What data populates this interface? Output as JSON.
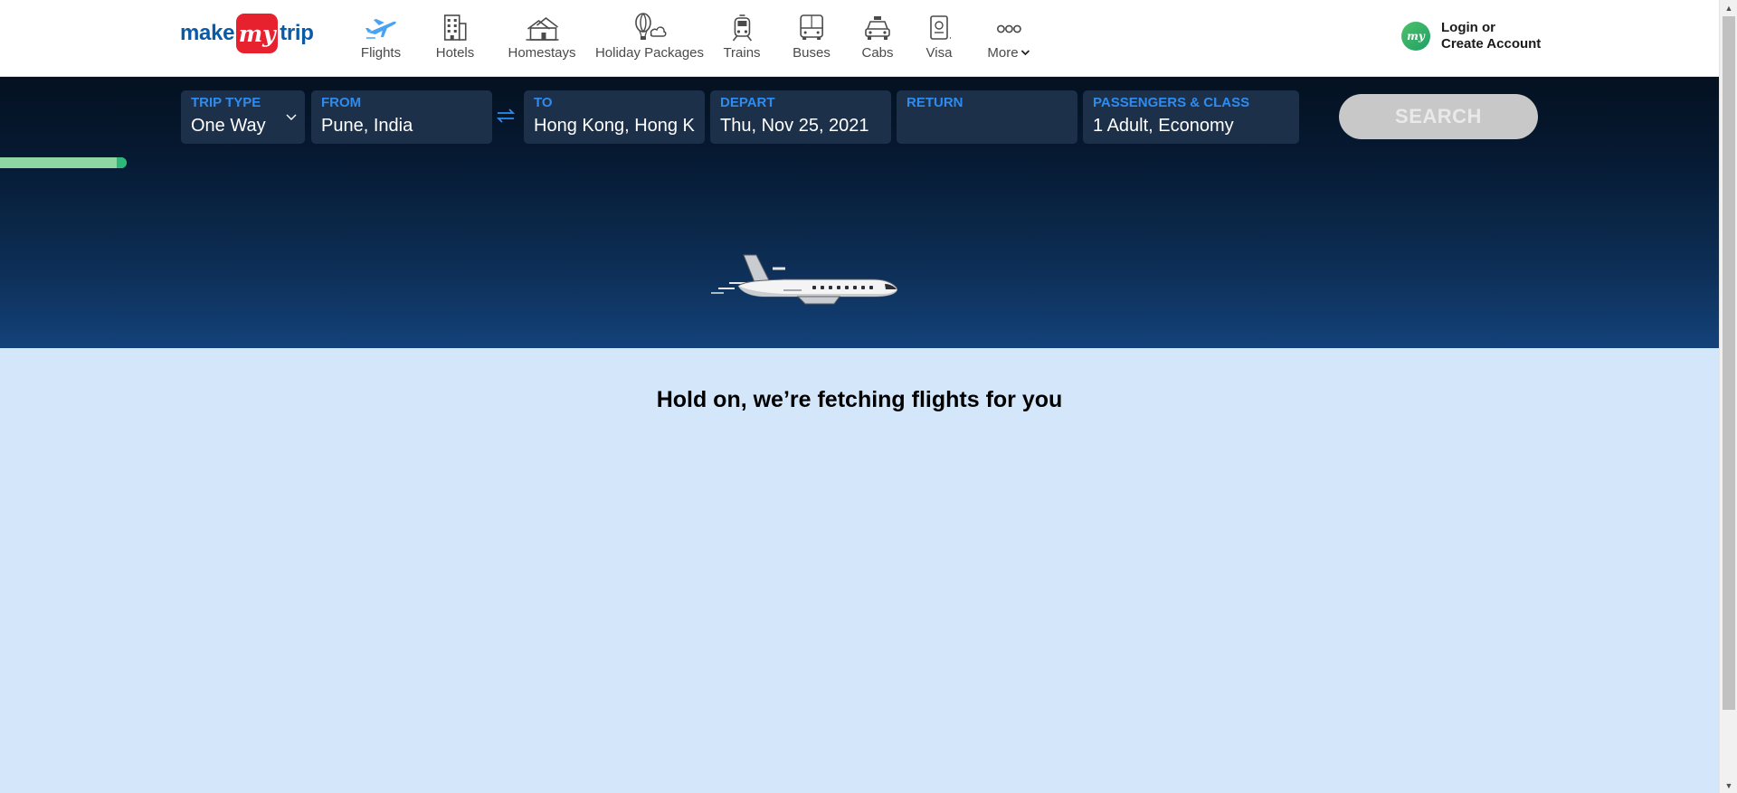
{
  "brand": {
    "logo_left": "make",
    "logo_mid": "my",
    "logo_right": "trip"
  },
  "nav": [
    {
      "key": "flights",
      "label": "Flights",
      "icon": "plane-icon",
      "active": true
    },
    {
      "key": "hotels",
      "label": "Hotels",
      "icon": "building-icon"
    },
    {
      "key": "homestays",
      "label": "Homestays",
      "icon": "house-icon"
    },
    {
      "key": "holiday",
      "label": "Holiday Packages",
      "icon": "balloon-icon"
    },
    {
      "key": "trains",
      "label": "Trains",
      "icon": "train-icon"
    },
    {
      "key": "buses",
      "label": "Buses",
      "icon": "bus-icon"
    },
    {
      "key": "cabs",
      "label": "Cabs",
      "icon": "taxi-icon"
    },
    {
      "key": "visa",
      "label": "Visa",
      "icon": "passport-icon"
    },
    {
      "key": "more",
      "label": "More",
      "icon": "more-dots-icon"
    }
  ],
  "account": {
    "line1": "Login or",
    "line2": "Create Account",
    "avatar_text": "my"
  },
  "search": {
    "trip_type": {
      "label": "TRIP TYPE",
      "value": "One Way"
    },
    "from": {
      "label": "FROM",
      "value": "Pune, India"
    },
    "to": {
      "label": "TO",
      "value": "Hong Kong, Hong Kong"
    },
    "depart": {
      "label": "DEPART",
      "value": "Thu, Nov 25, 2021"
    },
    "return": {
      "label": "RETURN",
      "value": ""
    },
    "passengers": {
      "label": "PASSENGERS & CLASS",
      "value": "1 Adult, Economy"
    },
    "button_label": "SEARCH"
  },
  "loading": {
    "message": "Hold on, we’re fetching flights for you"
  },
  "colors": {
    "accent": "#2e8cf0",
    "brand_red": "#e7212d",
    "brand_blue": "#0b5aa6",
    "page_bg": "#d3e6fa"
  }
}
